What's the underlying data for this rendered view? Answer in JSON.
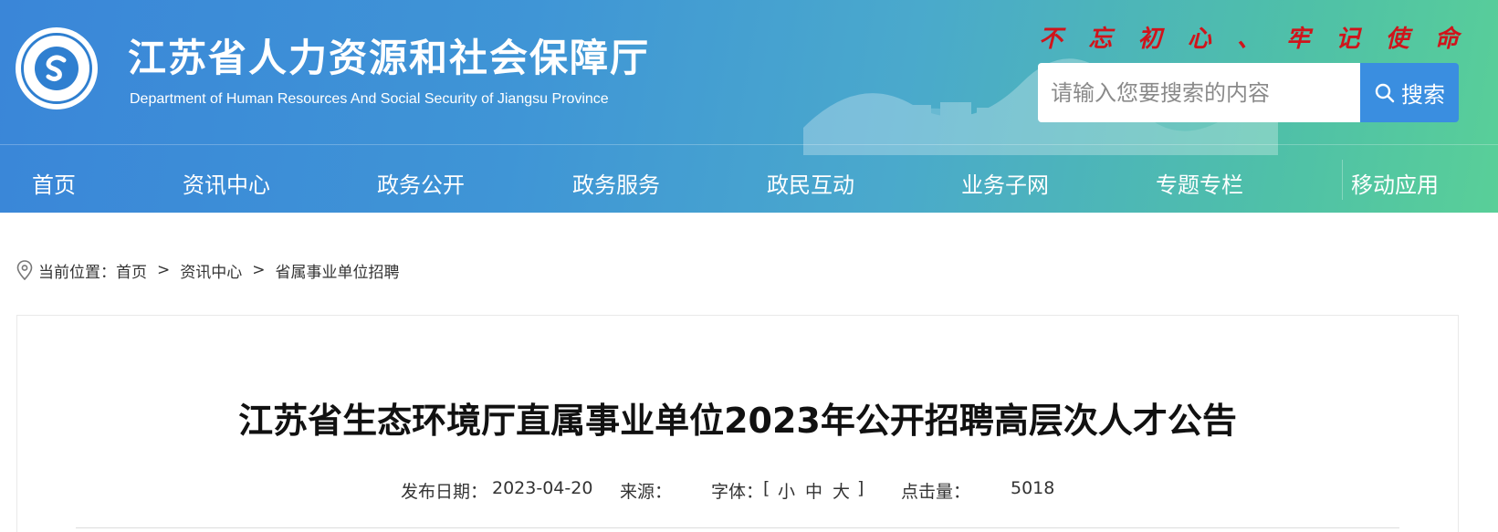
{
  "header": {
    "site_title": "江苏省人力资源和社会保障厅",
    "site_subtitle": "Department of Human Resources And Social Security of Jiangsu Province",
    "logo_ring_text": "江苏省人力资源和社会保障厅",
    "slogan": [
      "不",
      "忘",
      "初",
      "心",
      "、",
      "牢",
      "记",
      "使",
      "命"
    ],
    "colors": {
      "gradient_start": "#3a86d8",
      "gradient_end": "#59cf98",
      "slogan": "#d0141b",
      "search_button": "#3a8ee0"
    }
  },
  "search": {
    "placeholder": "请输入您要搜索的内容",
    "button_label": "搜索",
    "icon": "search-icon"
  },
  "nav": {
    "items": [
      "首页",
      "资讯中心",
      "政务公开",
      "政务服务",
      "政民互动",
      "业务子网",
      "专题专栏",
      "移动应用"
    ]
  },
  "breadcrumb": {
    "icon": "location-pin-icon",
    "label": "当前位置：",
    "items": [
      "首页",
      "资讯中心",
      "省属事业单位招聘"
    ],
    "separator": ">"
  },
  "article": {
    "title": "江苏省生态环境厅直属事业单位2023年公开招聘高层次人才公告",
    "meta": {
      "date_label": "发布日期：",
      "date": "2023-04-20",
      "source_label": "来源：",
      "source": "",
      "font_label": "字体：",
      "font_open": "[",
      "font_sizes": [
        "小",
        "中",
        "大"
      ],
      "font_close": "]",
      "views_label": "点击量：",
      "views": "5018"
    }
  }
}
